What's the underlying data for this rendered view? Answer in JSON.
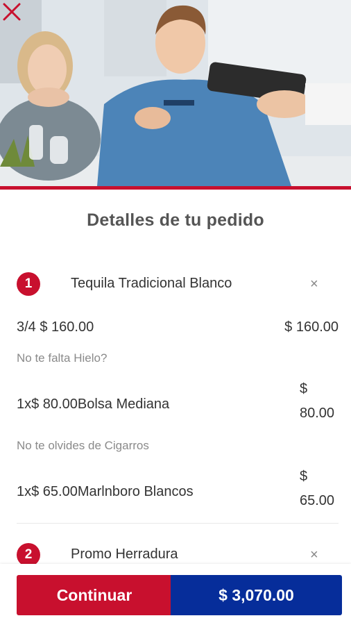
{
  "hero": {
    "image": "restaurant-card-payment-photo"
  },
  "title": "Detalles de tu pedido",
  "items": [
    {
      "number": "1",
      "name": "Tequila Tradicional Blanco",
      "remove": "×",
      "size_price": "3/4 $ 160.00",
      "line_total": "$ 160.00",
      "addon_sections": [
        {
          "label": "No te falta Hielo?",
          "addon": {
            "desc": "1x$ 80.00Bolsa Mediana",
            "currency": "$",
            "amount": "80.00"
          }
        },
        {
          "label": "No te olvides de Cigarros",
          "addon": {
            "desc": "1x$ 65.00Marlnboro Blancos",
            "currency": "$",
            "amount": "65.00"
          }
        }
      ]
    },
    {
      "number": "2",
      "name": "Promo Herradura",
      "remove": "×"
    }
  ],
  "footer": {
    "continue_label": "Continuar",
    "total_label": "$ 3,070.00"
  },
  "colors": {
    "brand_red": "#c8102e",
    "brand_blue": "#062d9a"
  },
  "icons": {
    "close": "close-icon",
    "remove": "remove-item-icon"
  }
}
